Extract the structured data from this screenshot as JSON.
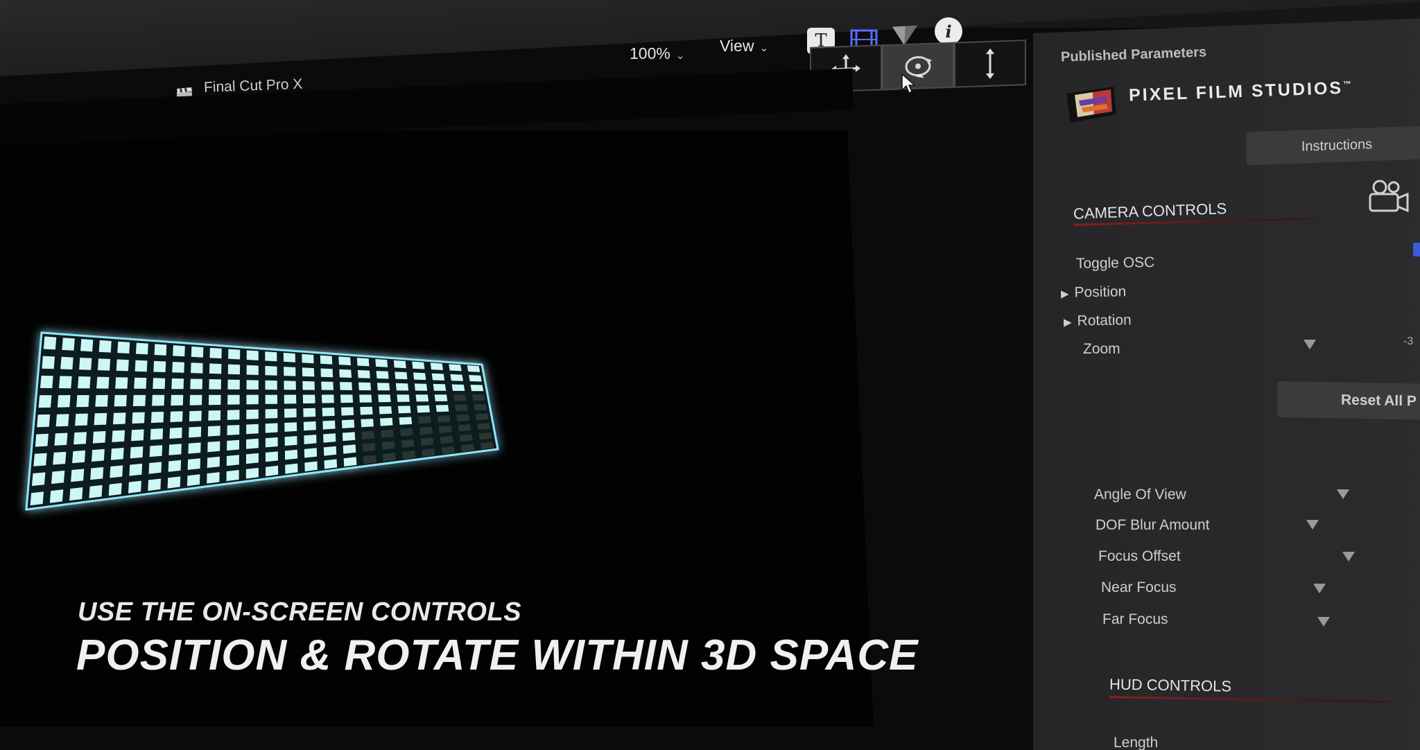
{
  "app": {
    "title": "Final Cut Pro X"
  },
  "toolbar": {
    "zoom_label": "100%",
    "view_label": "View",
    "title_tool_glyph": "T",
    "info_glyph": "i",
    "icons": [
      "title-icon",
      "film-strip-icon",
      "triangle-icon",
      "info-icon",
      "move-icon",
      "rotate-icon",
      "vertical-move-icon",
      "clapper-icon",
      "camera-icon"
    ]
  },
  "viewer": {
    "caption_line1": "USE THE ON-SCREEN CONTROLS",
    "caption_line2": "POSITION & ROTATE WITHIN 3D SPACE"
  },
  "inspector": {
    "heading": "Published Parameters",
    "brand_name": "PIXEL FILM STUDIOS",
    "brand_mark": "™",
    "instructions_label": "Instructions",
    "camera_section": "CAMERA CONTROLS",
    "camera_params": [
      {
        "label": "Toggle OSC"
      },
      {
        "label": "Position",
        "disclosure": "▶"
      },
      {
        "label": "Rotation",
        "disclosure": "▶"
      },
      {
        "label": "Zoom"
      }
    ],
    "zoom_value": "-3",
    "reset_label": "Reset All P",
    "lens_params": [
      {
        "label": "Angle Of View"
      },
      {
        "label": "DOF Blur Amount"
      },
      {
        "label": "Focus Offset"
      },
      {
        "label": "Near Focus"
      },
      {
        "label": "Far Focus"
      }
    ],
    "hud_section": "HUD CONTROLS",
    "hud_params": [
      {
        "label": "Length"
      }
    ]
  },
  "colors": {
    "accent_red": "#8a2020",
    "grid_cell": "#cdf6f6",
    "grid_glow": "#8fe6ff",
    "toggle_blue": "#3b5bd9"
  }
}
